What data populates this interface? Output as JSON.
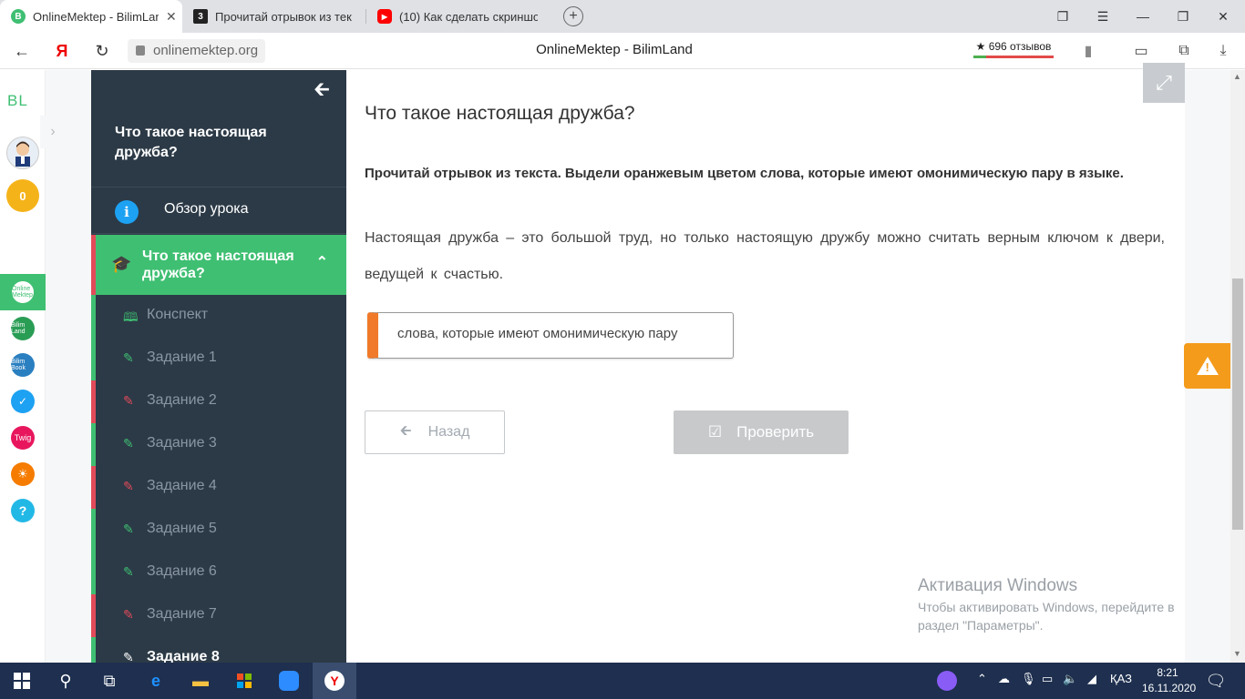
{
  "browser": {
    "tabs": [
      {
        "title": "OnlineMektep - BilimLand",
        "active": true,
        "favicon": "bilimland-icon",
        "color": "#3fbf72",
        "glyph": "B"
      },
      {
        "title": "Прочитай отрывок из тек",
        "active": false,
        "favicon": "znanija-icon",
        "color": "#222222",
        "glyph": "3"
      },
      {
        "title": "(10) Как сделать скриншо",
        "active": false,
        "favicon": "youtube-icon",
        "color": "#ff0000",
        "glyph": "▶"
      }
    ],
    "url": "onlinemektep.org",
    "page_title": "OnlineMektep - BilimLand",
    "reviews_label": "★ 696 отзывов"
  },
  "app": {
    "logo": "BL",
    "coins": "0",
    "services": [
      {
        "name": "onlinemektep",
        "label": "Online Mektep",
        "color": "#3fbf72"
      },
      {
        "name": "bilimland",
        "label": "Bilim Land",
        "color": "#2a9d55"
      },
      {
        "name": "bilimbook",
        "label": "Bilim Book",
        "color": "#2a7fc0"
      },
      {
        "name": "test",
        "label": "✓",
        "color": "#1da1f2"
      },
      {
        "name": "twig",
        "label": "Twig",
        "color": "#e8175d"
      },
      {
        "name": "imektep",
        "label": "☀",
        "color": "#f57c00"
      },
      {
        "name": "help",
        "label": "?",
        "color": "#22b8e6"
      }
    ]
  },
  "sidebar": {
    "lesson_title": "Что такое настоящая дружба?",
    "overview_label": "Обзор урока",
    "section_label": "Что такое настоящая дружба?",
    "items": [
      {
        "label": "Конспект",
        "status": "green",
        "icon": "book-icon"
      },
      {
        "label": "Задание 1",
        "status": "green",
        "icon": "edit-icon"
      },
      {
        "label": "Задание 2",
        "status": "red",
        "icon": "edit-icon"
      },
      {
        "label": "Задание 3",
        "status": "green",
        "icon": "edit-icon"
      },
      {
        "label": "Задание 4",
        "status": "red",
        "icon": "edit-icon"
      },
      {
        "label": "Задание 5",
        "status": "green",
        "icon": "edit-icon"
      },
      {
        "label": "Задание 6",
        "status": "green",
        "icon": "edit-icon"
      },
      {
        "label": "Задание 7",
        "status": "red",
        "icon": "edit-icon"
      },
      {
        "label": "Задание 8",
        "status": "current",
        "icon": "edit-icon"
      }
    ]
  },
  "task": {
    "title": "Что такое настоящая дружба?",
    "instruction": "Прочитай отрывок из текста. Выдели оранжевым цветом слова, которые имеют омонимическую пару в языке.",
    "paragraph": "Настоящая дружба – это большой труд, но только настоящую дружбу можно считать верным ключом к двери, ведущей к счастью.",
    "answer_label": "слова, которые имеют омонимическую пару",
    "back_label": "Назад",
    "check_label": "Проверить"
  },
  "watermark": {
    "title": "Активация Windows",
    "subtitle": "Чтобы активировать Windows, перейдите в раздел \"Параметры\"."
  },
  "taskbar": {
    "lang": "ҚАЗ",
    "time": "8:21",
    "date": "16.11.2020"
  },
  "colors": {
    "accent_green": "#3fbf72",
    "sidebar_bg": "#2c3a47",
    "highlight_orange": "#f07a2a",
    "error_red": "#e24a5a"
  }
}
